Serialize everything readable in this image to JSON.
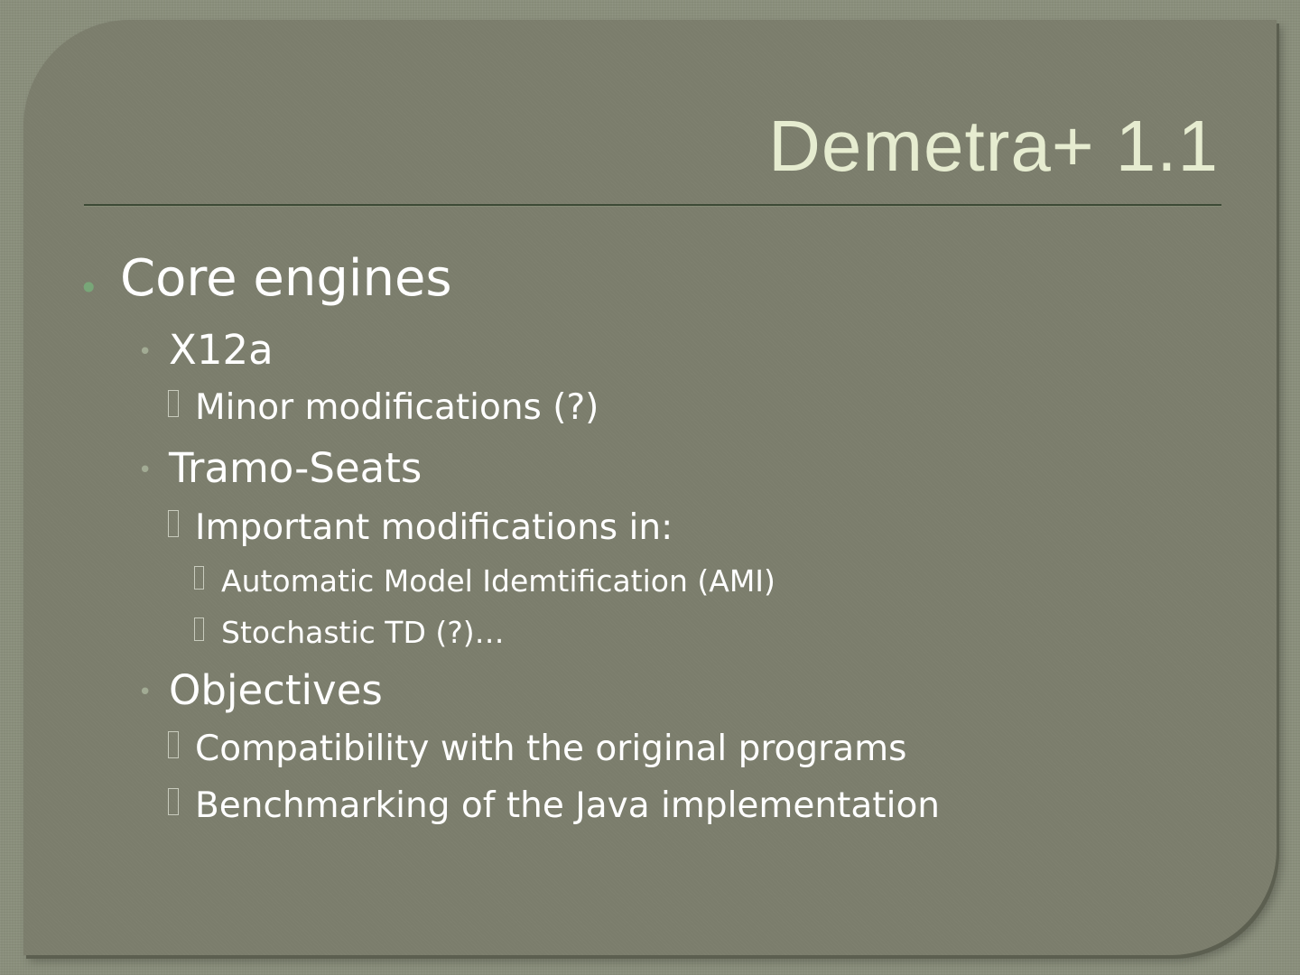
{
  "slide": {
    "title": "Demetra+ 1.1",
    "bullets": {
      "core_engines": "Core engines",
      "x12a": "X12a",
      "x12a_note": "Minor modifications  (?)",
      "tramo_seats": "Tramo-Seats",
      "tramo_note": "Important modifications in:",
      "ami": "Automatic Model Idemtification (AMI)",
      "stochastic_td": "Stochastic TD (?)…",
      "objectives": "Objectives",
      "compatibility": "Compatibility with the original programs",
      "benchmarking": "Benchmarking of the Java implementation"
    }
  },
  "colors": {
    "background": "#8a8f7c",
    "panel": "#7b7d6c",
    "title": "#e6ecd0",
    "body_text": "#ffffff",
    "level1_bullet": "#78a678",
    "rule": "#3d4a36"
  },
  "icons": {
    "level1_marker": "round-bullet",
    "level2_marker": "round-bullet",
    "level3_marker": "missing-glyph-box",
    "level4_marker": "missing-glyph-box"
  }
}
